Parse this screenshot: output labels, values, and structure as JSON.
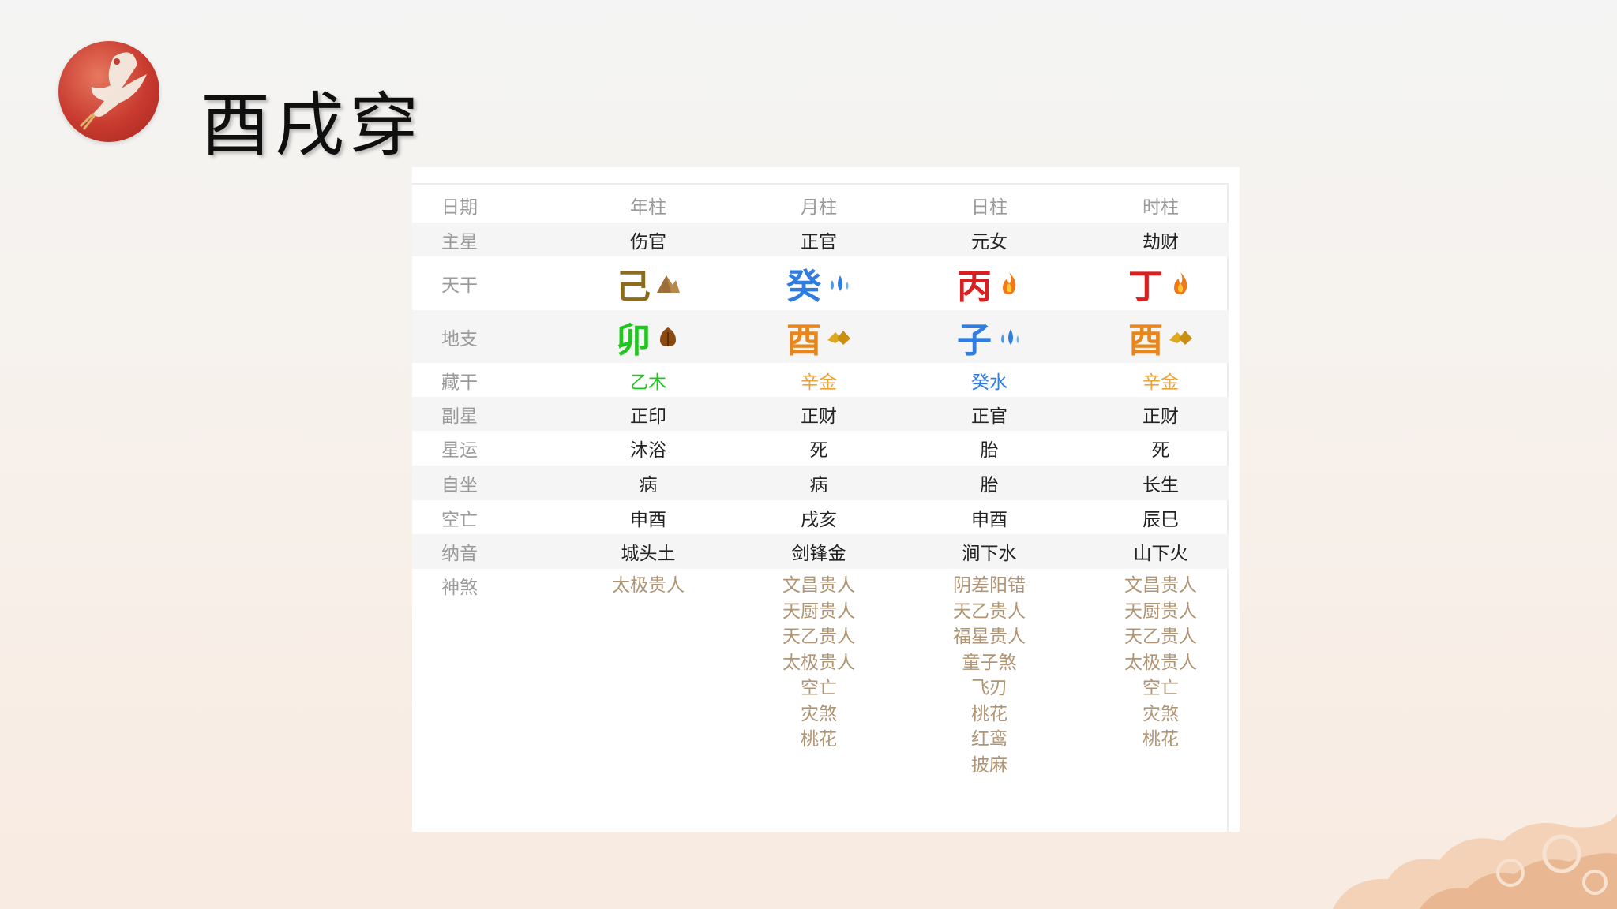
{
  "page": {
    "title": "酉戌穿"
  },
  "table": {
    "header": {
      "label": "日期",
      "cols": [
        "年柱",
        "月柱",
        "日柱",
        "时柱"
      ]
    },
    "zhuxing": {
      "label": "主星",
      "cols": [
        "伤官",
        "正官",
        "元女",
        "劫财"
      ]
    },
    "tiangan": {
      "label": "天干",
      "cols": [
        {
          "char": "己",
          "color": "#8b6d1f",
          "element": "earth-icon"
        },
        {
          "char": "癸",
          "color": "#2f7de1",
          "element": "water-icon"
        },
        {
          "char": "丙",
          "color": "#d91f1f",
          "element": "fire-icon"
        },
        {
          "char": "丁",
          "color": "#d91f1f",
          "element": "fire-icon"
        }
      ]
    },
    "dizhi": {
      "label": "地支",
      "cols": [
        {
          "char": "卯",
          "color": "#22c51f",
          "element": "wood-icon"
        },
        {
          "char": "酉",
          "color": "#e8861c",
          "element": "metal-icon"
        },
        {
          "char": "子",
          "color": "#2f7de1",
          "element": "water-icon"
        },
        {
          "char": "酉",
          "color": "#e8861c",
          "element": "metal-icon"
        }
      ]
    },
    "canggan": {
      "label": "藏干",
      "cols": [
        {
          "text": "乙木",
          "color": "#22c51f"
        },
        {
          "text": "辛金",
          "color": "#e8a33a"
        },
        {
          "text": "癸水",
          "color": "#2f7de1"
        },
        {
          "text": "辛金",
          "color": "#e8a33a"
        }
      ]
    },
    "fuxing": {
      "label": "副星",
      "cols": [
        "正印",
        "正财",
        "正官",
        "正财"
      ]
    },
    "xingyun": {
      "label": "星运",
      "cols": [
        "沐浴",
        "死",
        "胎",
        "死"
      ]
    },
    "zizuo": {
      "label": "自坐",
      "cols": [
        "病",
        "病",
        "胎",
        "长生"
      ]
    },
    "kongwang": {
      "label": "空亡",
      "cols": [
        "申酉",
        "戌亥",
        "申酉",
        "辰巳"
      ]
    },
    "nayin": {
      "label": "纳音",
      "cols": [
        "城头土",
        "剑锋金",
        "涧下水",
        "山下火"
      ]
    },
    "shensha": {
      "label": "神煞",
      "cols": [
        [
          "太极贵人"
        ],
        [
          "文昌贵人",
          "天厨贵人",
          "天乙贵人",
          "太极贵人",
          "空亡",
          "灾煞",
          "桃花"
        ],
        [
          "阴差阳错",
          "天乙贵人",
          "福星贵人",
          "童子煞",
          "飞刃",
          "桃花",
          "红鸾",
          "披麻"
        ],
        [
          "文昌贵人",
          "天厨贵人",
          "天乙贵人",
          "太极贵人",
          "空亡",
          "灾煞",
          "桃花"
        ]
      ]
    }
  },
  "logo": {
    "icon": "crane-emblem-icon"
  },
  "decoration": {
    "icon": "cloud-pattern-icon"
  }
}
